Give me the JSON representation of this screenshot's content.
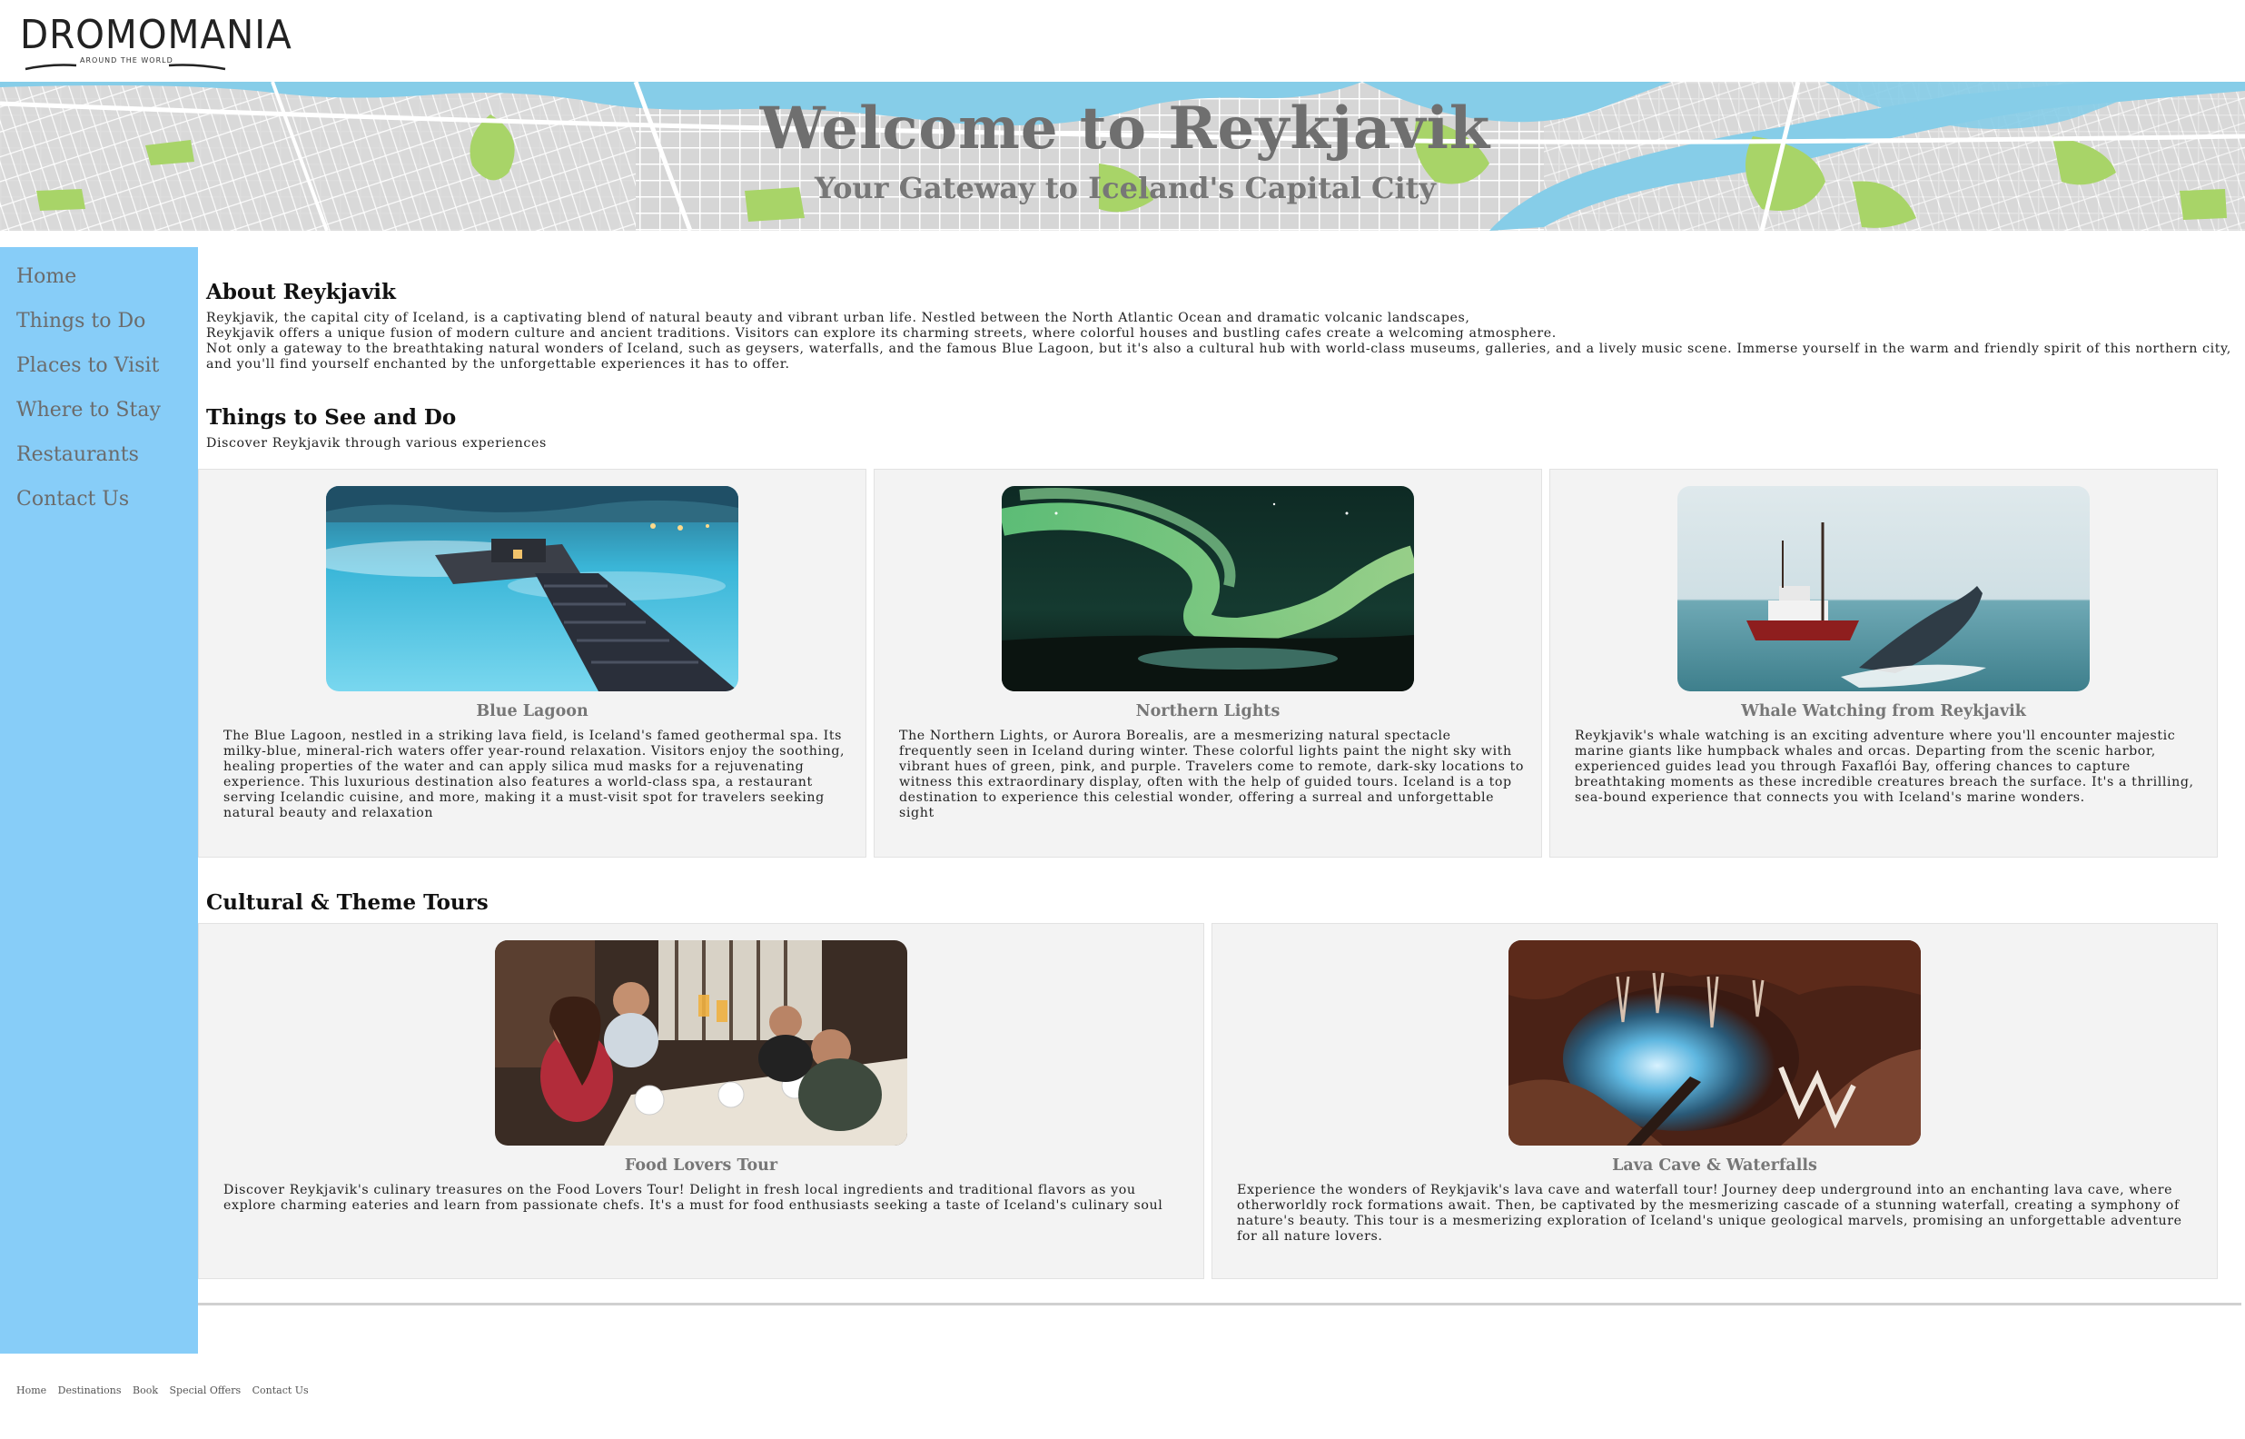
{
  "logo": {
    "name": "DROMOMANIA",
    "tagline": "AROUND THE WORLD"
  },
  "banner": {
    "title": "Welcome to Reykjavik",
    "subtitle": "Your Gateway to Iceland's Capital City"
  },
  "sidebar": {
    "items": [
      {
        "label": "Home"
      },
      {
        "label": "Things to Do"
      },
      {
        "label": "Places to Visit"
      },
      {
        "label": "Where to Stay"
      },
      {
        "label": "Restaurants"
      },
      {
        "label": "Contact Us"
      }
    ]
  },
  "about": {
    "heading": "About Reykjavik",
    "lines": [
      "Reykjavik, the capital city of Iceland, is a captivating blend of natural beauty and vibrant urban life. Nestled between the North Atlantic Ocean and dramatic volcanic landscapes,",
      "Reykjavik offers a unique fusion of modern culture and ancient traditions. Visitors can explore its charming streets, where colorful houses and bustling cafes create a welcoming atmosphere.",
      "Not only a gateway to the breathtaking natural wonders of Iceland, such as geysers, waterfalls, and the famous Blue Lagoon, but it's also a cultural hub with world-class museums, galleries, and a lively music scene. Immerse yourself in the warm and friendly spirit of this northern city, and you'll find yourself enchanted by the unforgettable experiences it has to offer."
    ]
  },
  "things": {
    "heading": "Things to See and Do",
    "description": "Discover Reykjavik through various experiences",
    "cards": [
      {
        "title": "Blue Lagoon",
        "text": "The Blue Lagoon, nestled in a striking lava field, is Iceland's famed geothermal spa. Its milky-blue, mineral-rich waters offer year-round relaxation. Visitors enjoy the soothing, healing properties of the water and can apply silica mud masks for a rejuvenating experience. This luxurious destination also features a world-class spa, a restaurant serving Icelandic cuisine, and more, making it a must-visit spot for travelers seeking natural beauty and relaxation"
      },
      {
        "title": "Northern Lights",
        "text": "The Northern Lights, or Aurora Borealis, are a mesmerizing natural spectacle frequently seen in Iceland during winter. These colorful lights paint the night sky with vibrant hues of green, pink, and purple. Travelers come to remote, dark-sky locations to witness this extraordinary display, often with the help of guided tours. Iceland is a top destination to experience this celestial wonder, offering a surreal and unforgettable sight"
      },
      {
        "title": "Whale Watching from Reykjavik",
        "text": "Reykjavik's whale watching is an exciting adventure where you'll encounter majestic marine giants like humpback whales and orcas. Departing from the scenic harbor, experienced guides lead you through Faxaflói Bay, offering chances to capture breathtaking moments as these incredible creatures breach the surface. It's a thrilling, sea-bound experience that connects you with Iceland's marine wonders."
      }
    ]
  },
  "tours": {
    "heading": "Cultural & Theme Tours",
    "cards": [
      {
        "title": "Food Lovers Tour",
        "text": "Discover Reykjavik's culinary treasures on the Food Lovers Tour! Delight in fresh local ingredients and traditional flavors as you explore charming eateries and learn from passionate chefs. It's a must for food enthusiasts seeking a taste of Iceland's culinary soul"
      },
      {
        "title": "Lava Cave & Waterfalls",
        "text": "Experience the wonders of Reykjavik's lava cave and waterfall tour! Journey deep underground into an enchanting lava cave, where otherworldly rock formations await. Then, be captivated by the mesmerizing cascade of a stunning waterfall, creating a symphony of nature's beauty. This tour is a mesmerizing exploration of Iceland's unique geological marvels, promising an unforgettable adventure for all nature lovers."
      }
    ]
  },
  "footer": {
    "links": [
      "Home",
      "Destinations",
      "Book",
      "Special Offers",
      "Contact Us"
    ]
  },
  "colors": {
    "sidebar": "#87cdf8",
    "card_bg": "#f3f3f3",
    "map_water": "#86cde8",
    "map_park": "#a8d468"
  }
}
